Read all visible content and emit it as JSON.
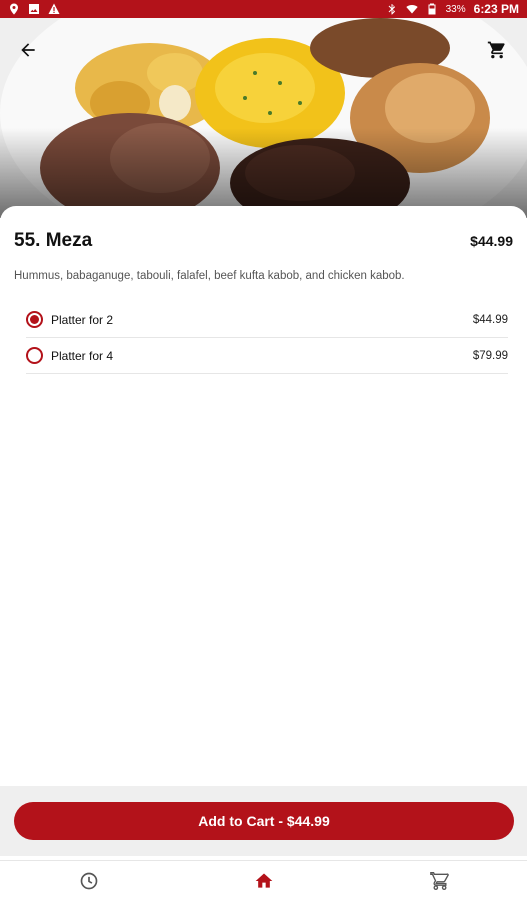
{
  "status_bar": {
    "battery": "33%",
    "time": "6:23 PM"
  },
  "item": {
    "title": "55. Meza",
    "price": "$44.99",
    "description": "Hummus, babaganuge, tabouli, falafel, beef kufta kabob, and chicken kabob."
  },
  "options": [
    {
      "label": "Platter for 2",
      "price": "$44.99",
      "selected": true
    },
    {
      "label": "Platter for 4",
      "price": "$79.99",
      "selected": false
    }
  ],
  "cart_button": {
    "label": "Add to Cart - $44.99"
  },
  "colors": {
    "accent": "#b3121a",
    "footer_bg": "#efefef"
  },
  "icons": {
    "back": "arrow-left-icon",
    "cart": "cart-icon",
    "orders": "clock-icon",
    "home": "home-icon",
    "nav_cart": "cart-icon"
  }
}
